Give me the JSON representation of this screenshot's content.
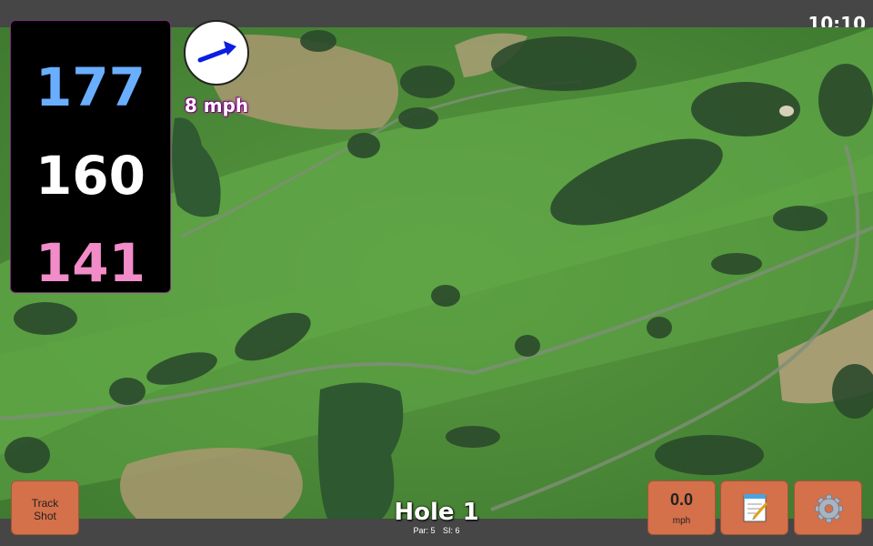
{
  "status": {
    "time": "10:10"
  },
  "distances": {
    "back": "177",
    "center": "160",
    "front": "141"
  },
  "wind": {
    "speed_label": "8 mph",
    "direction_icon": "wind-arrow-icon",
    "arrow_color": "#0a1fe0"
  },
  "hole": {
    "title": "Hole 1",
    "par_label": "Par: 5",
    "si_label": "SI: 6"
  },
  "buttons": {
    "track_shot_line1": "Track",
    "track_shot_line2": "Shot",
    "speed_value": "0.0",
    "speed_unit": "mph",
    "notes_icon": "notepad-icon",
    "settings_icon": "gear-icon"
  },
  "colors": {
    "button_bg": "#d4704a",
    "back_distance": "#6aaeff",
    "front_distance": "#f28cc8",
    "wind_label_outline": "#800080"
  }
}
